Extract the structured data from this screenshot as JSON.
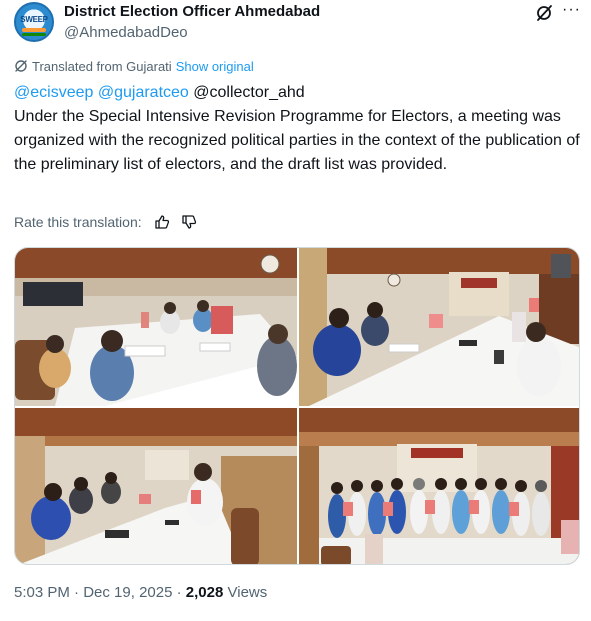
{
  "account": {
    "display_name": "District Election Officer Ahmedabad",
    "handle": "@AhmedabadDeo",
    "avatar_text": "SWEEP"
  },
  "translation": {
    "label": "Translated from Gujarati",
    "show_original": "Show original",
    "rate_label": "Rate this translation:"
  },
  "tweet": {
    "mention_1": "@ecisveep",
    "mention_2": "@gujaratceo",
    "mention_3": "@collector_ahd",
    "body": "Under the Special Intensive Revision Programme for Electors, a meeting was organized with the recognized political parties in the context of the publication of the preliminary list of electors, and the draft list was provided."
  },
  "meta": {
    "time": "5:03 PM",
    "separator": "·",
    "date": "Dec 19, 2025",
    "views_count": "2,028",
    "views_label": "Views"
  },
  "icons": {
    "grok": "grok-icon",
    "more": "more-icon",
    "translate": "translate-icon",
    "thumbs_up": "thumbs-up-icon",
    "thumbs_down": "thumbs-down-icon"
  },
  "colors": {
    "link": "#1d9bf0",
    "secondary_text": "#536471",
    "primary_text": "#0f1419"
  }
}
